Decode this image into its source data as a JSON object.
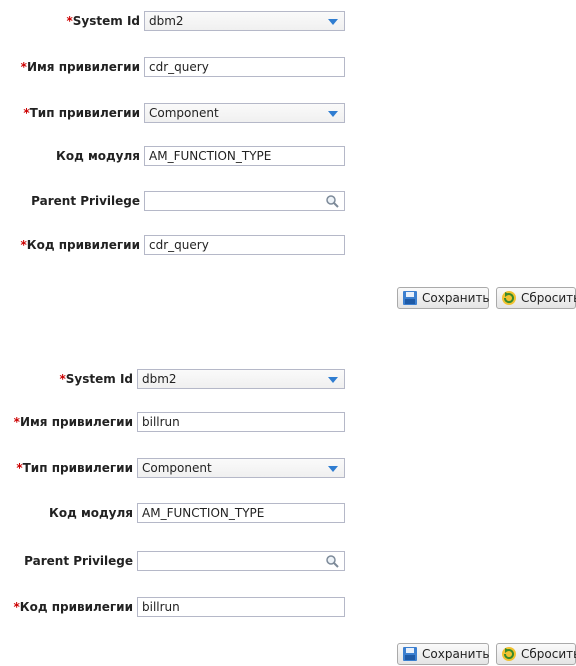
{
  "forms": [
    {
      "system_id": {
        "required": "*",
        "label": "System Id",
        "value": "dbm2"
      },
      "privilege_name": {
        "required": "*",
        "label": "Имя привилегии",
        "value": "cdr_query"
      },
      "privilege_type": {
        "required": "*",
        "label": "Тип привилегии",
        "value": "Component"
      },
      "module_code": {
        "label": "Код модуля",
        "value": "AM_FUNCTION_TYPE"
      },
      "parent_privilege": {
        "label": "Parent Privilege",
        "value": ""
      },
      "privilege_code": {
        "required": "*",
        "label": "Код привилегии",
        "value": "cdr_query"
      },
      "save_label": "Сохранить",
      "reset_label": "Сбросить"
    },
    {
      "system_id": {
        "required": "*",
        "label": "System Id",
        "value": "dbm2"
      },
      "privilege_name": {
        "required": "*",
        "label": "Имя привилегии",
        "value": "billrun"
      },
      "privilege_type": {
        "required": "*",
        "label": "Тип привилегии",
        "value": "Component"
      },
      "module_code": {
        "label": "Код модуля",
        "value": "AM_FUNCTION_TYPE"
      },
      "parent_privilege": {
        "label": "Parent Privilege",
        "value": ""
      },
      "privilege_code": {
        "required": "*",
        "label": "Код привилегии",
        "value": "billrun"
      },
      "save_label": "Сохранить",
      "reset_label": "Сбросить"
    }
  ],
  "icons": {
    "dropdown": "chevron-down-icon",
    "search": "search-icon",
    "save": "save-icon",
    "reset": "reset-icon"
  },
  "colors": {
    "required_marker": "#cc0000",
    "dropdown_arrow": "#2f7dd1",
    "field_border": "#b5b8c8"
  }
}
